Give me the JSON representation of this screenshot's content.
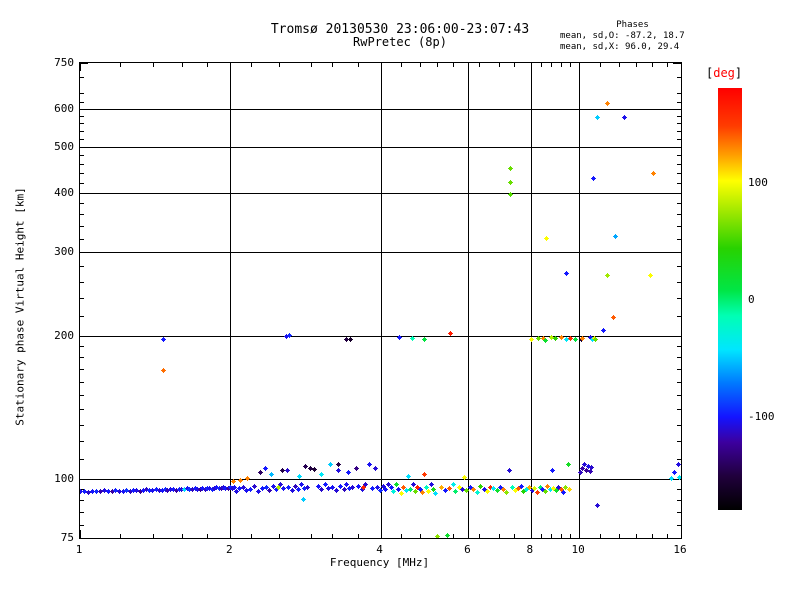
{
  "title": {
    "line1": "Tromsø 20130530 23:06:00-23:07:43",
    "line2": "RwPretec (8p)"
  },
  "stats": {
    "header": "Phases",
    "line_o": "mean, sd,O: -87.2, 18.7",
    "line_x": "mean, sd,X:  96.0, 29.4"
  },
  "colorbar": {
    "bracket_open": "[",
    "unit": "deg",
    "bracket_close": "]",
    "unit_color": "#ff0000",
    "min": -180,
    "max": 180,
    "tick_values": [
      100,
      0,
      -100
    ],
    "tick_labels": [
      "100",
      "0",
      "-100"
    ]
  },
  "chart_data": {
    "type": "scatter",
    "title": "Tromsø 20130530 23:06:00-23:07:43  RwPretec (8p)",
    "xlabel": "Frequency [MHz]",
    "ylabel": "Stationary phase Virtual Height [km]",
    "xscale": "log",
    "yscale": "log",
    "xlim": [
      1,
      16
    ],
    "ylim": [
      75,
      750
    ],
    "xticks": [
      1,
      2,
      4,
      6,
      8,
      10,
      16
    ],
    "xtick_labels": [
      "1",
      "2",
      "4",
      "6",
      "8",
      "10",
      "16"
    ],
    "yticks": [
      75,
      100,
      200,
      300,
      400,
      500,
      600,
      750
    ],
    "ytick_labels": [
      "75",
      "100",
      "200",
      "300",
      "400",
      "500",
      "600",
      "750"
    ],
    "xgrid": [
      2,
      4,
      6,
      8,
      10
    ],
    "ygrid": [
      100,
      200,
      300,
      400,
      500,
      600
    ],
    "xminor": [
      1.2,
      1.4,
      1.6,
      1.8,
      2.2,
      2.5,
      2.9,
      3.2,
      3.6,
      4.4,
      4.8,
      5.2,
      5.6,
      6.3,
      6.9,
      7.4,
      8.4,
      8.8,
      9.2,
      9.6,
      11,
      12,
      13,
      14,
      15
    ],
    "yminor": [
      80,
      85,
      90,
      95,
      110,
      120,
      130,
      140,
      150,
      160,
      170,
      180,
      190,
      220,
      240,
      260,
      280,
      320,
      340,
      360,
      380,
      420,
      440,
      460,
      480,
      520,
      540,
      560,
      580,
      620,
      650,
      700
    ],
    "grid": true,
    "legend_position": "right-colorbar",
    "color_scale": {
      "label": "[deg]",
      "min": -180,
      "max": 180,
      "ticks": [
        100,
        0,
        -100
      ]
    },
    "colormap": [
      [
        0.0,
        "#000000"
      ],
      [
        0.08,
        "#20003c"
      ],
      [
        0.16,
        "#3c009e"
      ],
      [
        0.22,
        "#1414ff"
      ],
      [
        0.3,
        "#0078ff"
      ],
      [
        0.38,
        "#00e6ff"
      ],
      [
        0.46,
        "#00ffb4"
      ],
      [
        0.52,
        "#00e646"
      ],
      [
        0.62,
        "#28d200"
      ],
      [
        0.7,
        "#96e600"
      ],
      [
        0.78,
        "#ffff00"
      ],
      [
        0.84,
        "#ffa000"
      ],
      [
        0.91,
        "#ff3c00"
      ],
      [
        1.0,
        "#ff0000"
      ]
    ],
    "point_format": [
      "frequency_MHz",
      "virtual_height_km",
      "phase_deg"
    ],
    "points": [
      [
        1.0,
        93.9,
        -105
      ],
      [
        1.02,
        94.1,
        -98
      ],
      [
        1.04,
        93.7,
        -112
      ],
      [
        1.06,
        94.2,
        -102
      ],
      [
        1.08,
        93.8,
        -95
      ],
      [
        1.1,
        94.0,
        -118
      ],
      [
        1.12,
        94.3,
        -108
      ],
      [
        1.14,
        93.9,
        -100
      ],
      [
        1.16,
        94.1,
        -122
      ],
      [
        1.18,
        94.4,
        -96
      ],
      [
        1.2,
        94.0,
        -110
      ],
      [
        1.22,
        94.2,
        -104
      ],
      [
        1.24,
        94.5,
        -92
      ],
      [
        1.26,
        94.1,
        -115
      ],
      [
        1.28,
        94.3,
        -99
      ],
      [
        1.3,
        94.6,
        -107
      ],
      [
        1.32,
        94.2,
        -125
      ],
      [
        1.34,
        94.4,
        -101
      ],
      [
        1.36,
        94.7,
        -113
      ],
      [
        1.38,
        94.3,
        -97
      ],
      [
        1.4,
        94.5,
        -105
      ],
      [
        1.42,
        94.8,
        -98
      ],
      [
        1.44,
        94.4,
        -112
      ],
      [
        1.46,
        94.6,
        -102
      ],
      [
        1.48,
        94.9,
        -95
      ],
      [
        1.5,
        94.5,
        -118
      ],
      [
        1.52,
        94.7,
        -108
      ],
      [
        1.54,
        95.0,
        -100
      ],
      [
        1.56,
        94.6,
        -122
      ],
      [
        1.58,
        94.8,
        -96
      ],
      [
        1.6,
        95.1,
        -110
      ],
      [
        1.62,
        94.9,
        -45
      ],
      [
        1.64,
        95.2,
        -104
      ],
      [
        1.66,
        94.8,
        -92
      ],
      [
        1.68,
        95.0,
        -115
      ],
      [
        1.7,
        95.3,
        -99
      ],
      [
        1.72,
        94.9,
        -107
      ],
      [
        1.74,
        95.1,
        -125
      ],
      [
        1.76,
        95.4,
        -101
      ],
      [
        1.78,
        95.0,
        -113
      ],
      [
        1.8,
        95.2,
        -97
      ],
      [
        1.82,
        95.5,
        -105
      ],
      [
        1.84,
        95.1,
        -98
      ],
      [
        1.86,
        95.3,
        -112
      ],
      [
        1.88,
        95.6,
        -102
      ],
      [
        1.9,
        95.2,
        -95
      ],
      [
        1.92,
        95.4,
        -118
      ],
      [
        1.94,
        95.7,
        -108
      ],
      [
        1.96,
        95.3,
        -100
      ],
      [
        1.98,
        95.5,
        -122
      ],
      [
        2.0,
        95.8,
        -96
      ],
      [
        2.02,
        95.4,
        -110
      ],
      [
        2.04,
        95.6,
        -104
      ],
      [
        2.03,
        98.5,
        130
      ],
      [
        2.06,
        94.0,
        -108
      ],
      [
        2.09,
        95.5,
        -100
      ],
      [
        2.1,
        99.0,
        130
      ],
      [
        2.13,
        96.0,
        -110
      ],
      [
        2.16,
        94.5,
        -104
      ],
      [
        2.17,
        100.0,
        130
      ],
      [
        2.2,
        95.0,
        -98
      ],
      [
        2.24,
        96.5,
        -112
      ],
      [
        2.28,
        94.0,
        -106
      ],
      [
        2.3,
        103.0,
        -140
      ],
      [
        2.32,
        95.5,
        -100
      ],
      [
        2.35,
        105.0,
        -100
      ],
      [
        2.36,
        96.0,
        -95
      ],
      [
        2.4,
        94.5,
        -118
      ],
      [
        2.42,
        102.0,
        -55
      ],
      [
        2.44,
        96.5,
        -105
      ],
      [
        2.48,
        95.0,
        -100
      ],
      [
        2.5,
        96.0,
        80
      ],
      [
        2.52,
        97.0,
        -110
      ],
      [
        2.55,
        104.0,
        -148
      ],
      [
        2.56,
        95.5,
        -103
      ],
      [
        2.6,
        104.0,
        -112
      ],
      [
        2.62,
        96.0,
        -98
      ],
      [
        2.66,
        94.5,
        -108
      ],
      [
        2.7,
        96.5,
        -115
      ],
      [
        2.74,
        95.0,
        -100
      ],
      [
        2.75,
        101.0,
        -45
      ],
      [
        2.78,
        97.0,
        -105
      ],
      [
        2.8,
        90.5,
        -50
      ],
      [
        2.82,
        95.5,
        -96
      ],
      [
        2.83,
        106.0,
        -145
      ],
      [
        2.86,
        96.0,
        -110
      ],
      [
        2.9,
        105.0,
        -150
      ],
      [
        2.95,
        104.5,
        -155
      ],
      [
        3.0,
        96.5,
        -102
      ],
      [
        3.05,
        102.0,
        -40
      ],
      [
        3.05,
        95.0,
        -112
      ],
      [
        3.1,
        97.0,
        -99
      ],
      [
        3.15,
        95.5,
        -107
      ],
      [
        3.18,
        107.0,
        -50
      ],
      [
        3.2,
        96.0,
        -103
      ],
      [
        3.26,
        94.5,
        -110
      ],
      [
        3.3,
        107.0,
        -148
      ],
      [
        3.3,
        104.0,
        -108
      ],
      [
        3.33,
        96.5,
        -100
      ],
      [
        3.38,
        95.0,
        -115
      ],
      [
        3.42,
        97.0,
        -104
      ],
      [
        3.45,
        103.0,
        -100
      ],
      [
        3.47,
        95.5,
        -98
      ],
      [
        3.52,
        96.0,
        -110
      ],
      [
        3.58,
        105.0,
        -130
      ],
      [
        3.62,
        96.5,
        -101
      ],
      [
        3.68,
        95.0,
        -108
      ],
      [
        3.7,
        96.0,
        160
      ],
      [
        3.74,
        97.0,
        -112
      ],
      [
        3.8,
        107.0,
        -104
      ],
      [
        3.85,
        95.5,
        -99
      ],
      [
        3.9,
        105.0,
        -110
      ],
      [
        3.95,
        96.0,
        -105
      ],
      [
        4.0,
        94.5,
        -95
      ],
      [
        4.05,
        96.5,
        -108
      ],
      [
        4.1,
        95.0,
        -102
      ],
      [
        4.15,
        97.0,
        -110
      ],
      [
        4.2,
        96.0,
        -100
      ],
      [
        4.25,
        94.0,
        -30
      ],
      [
        4.3,
        97.0,
        20
      ],
      [
        4.35,
        95.0,
        -105
      ],
      [
        4.4,
        93.0,
        100
      ],
      [
        4.45,
        96.0,
        140
      ],
      [
        4.5,
        94.5,
        -40
      ],
      [
        4.55,
        101.0,
        -45
      ],
      [
        4.6,
        95.0,
        0
      ],
      [
        4.65,
        97.0,
        -110
      ],
      [
        4.7,
        94.0,
        60
      ],
      [
        4.75,
        96.0,
        165
      ],
      [
        4.8,
        95.0,
        -100
      ],
      [
        4.85,
        93.5,
        130
      ],
      [
        4.9,
        102.0,
        150
      ],
      [
        4.95,
        96.0,
        -20
      ],
      [
        5.0,
        94.0,
        100
      ],
      [
        5.05,
        97.0,
        -108
      ],
      [
        5.1,
        95.0,
        30
      ],
      [
        5.15,
        93.0,
        -45
      ],
      [
        5.2,
        75.5,
        70
      ],
      [
        5.3,
        96.0,
        120
      ],
      [
        5.4,
        94.5,
        -100
      ],
      [
        5.45,
        76.0,
        20
      ],
      [
        5.5,
        95.5,
        140
      ],
      [
        5.6,
        97.0,
        -35
      ],
      [
        5.65,
        94.0,
        0
      ],
      [
        5.75,
        96.0,
        100
      ],
      [
        5.85,
        95.0,
        -110
      ],
      [
        5.9,
        100.5,
        100
      ],
      [
        5.95,
        94.5,
        60
      ],
      [
        6.05,
        96.0,
        -100
      ],
      [
        6.15,
        95.0,
        130
      ],
      [
        6.25,
        93.5,
        -25
      ],
      [
        6.35,
        96.5,
        45
      ],
      [
        6.45,
        95.0,
        -105
      ],
      [
        6.55,
        94.0,
        100
      ],
      [
        6.65,
        96.0,
        160
      ],
      [
        6.75,
        95.5,
        -40
      ],
      [
        6.85,
        94.5,
        20
      ],
      [
        6.95,
        96.0,
        -100
      ],
      [
        7.05,
        95.0,
        130
      ],
      [
        7.15,
        93.5,
        70
      ],
      [
        7.25,
        104.0,
        -110
      ],
      [
        7.35,
        96.0,
        -15
      ],
      [
        7.45,
        94.5,
        100
      ],
      [
        7.55,
        95.5,
        140
      ],
      [
        7.65,
        96.5,
        -100
      ],
      [
        7.75,
        94.0,
        40
      ],
      [
        7.85,
        95.0,
        -30
      ],
      [
        7.95,
        96.0,
        120
      ],
      [
        8.05,
        94.5,
        -108
      ],
      [
        8.15,
        95.5,
        90
      ],
      [
        8.25,
        93.5,
        150
      ],
      [
        8.35,
        96.0,
        0
      ],
      [
        8.45,
        95.0,
        -100
      ],
      [
        8.55,
        94.0,
        60
      ],
      [
        8.65,
        96.5,
        130
      ],
      [
        8.75,
        95.0,
        -40
      ],
      [
        8.85,
        104.0,
        -100
      ],
      [
        8.9,
        95.5,
        100
      ],
      [
        9.0,
        94.5,
        20
      ],
      [
        9.1,
        96.0,
        -110
      ],
      [
        9.2,
        95.0,
        140
      ],
      [
        9.3,
        93.5,
        -100
      ],
      [
        9.4,
        96.0,
        70
      ],
      [
        9.5,
        107.0,
        25
      ],
      [
        9.55,
        95.0,
        110
      ],
      [
        10.05,
        103.0,
        -115
      ],
      [
        10.15,
        105.0,
        -120
      ],
      [
        10.25,
        107.0,
        -110
      ],
      [
        10.35,
        104.0,
        -125
      ],
      [
        10.45,
        106.0,
        -105
      ],
      [
        10.55,
        103.5,
        -118
      ],
      [
        10.6,
        105.5,
        -112
      ],
      [
        10.9,
        88.0,
        -110
      ],
      [
        15.3,
        100.0,
        -45
      ],
      [
        15.55,
        103.0,
        -100
      ],
      [
        15.8,
        107.0,
        -108
      ],
      [
        15.9,
        100.5,
        -40
      ],
      [
        1.47,
        196,
        -100
      ],
      [
        1.47,
        169,
        135
      ],
      [
        2.59,
        199,
        -105
      ],
      [
        2.63,
        200,
        -95
      ],
      [
        3.42,
        196,
        -150
      ],
      [
        3.49,
        196,
        -160
      ],
      [
        4.37,
        198,
        -100
      ],
      [
        4.63,
        197,
        -15
      ],
      [
        4.9,
        196,
        10
      ],
      [
        5.52,
        202,
        165
      ],
      [
        8.02,
        196,
        100
      ],
      [
        8.3,
        197,
        60
      ],
      [
        8.5,
        197,
        130
      ],
      [
        8.55,
        195,
        20
      ],
      [
        8.8,
        198,
        80
      ],
      [
        8.95,
        197,
        45
      ],
      [
        9.2,
        198,
        130
      ],
      [
        9.45,
        196,
        -40
      ],
      [
        9.6,
        197,
        155
      ],
      [
        9.85,
        196,
        10
      ],
      [
        10.1,
        196,
        -155
      ],
      [
        10.15,
        197,
        130
      ],
      [
        10.55,
        198,
        -105
      ],
      [
        10.65,
        196,
        -45
      ],
      [
        10.75,
        197,
        105
      ],
      [
        10.8,
        196,
        60
      ],
      [
        11.2,
        205,
        -100
      ],
      [
        7.3,
        449,
        60
      ],
      [
        7.3,
        421,
        60
      ],
      [
        7.3,
        397,
        55
      ],
      [
        8.6,
        321,
        100
      ],
      [
        11.85,
        323,
        -60
      ],
      [
        9.45,
        271,
        -100
      ],
      [
        11.4,
        268,
        75
      ],
      [
        13.9,
        268,
        100
      ],
      [
        11.7,
        218,
        140
      ],
      [
        11.4,
        615,
        130
      ],
      [
        10.9,
        577,
        -50
      ],
      [
        12.3,
        575,
        -105
      ],
      [
        14.1,
        440,
        130
      ],
      [
        10.7,
        428,
        -100
      ]
    ]
  }
}
